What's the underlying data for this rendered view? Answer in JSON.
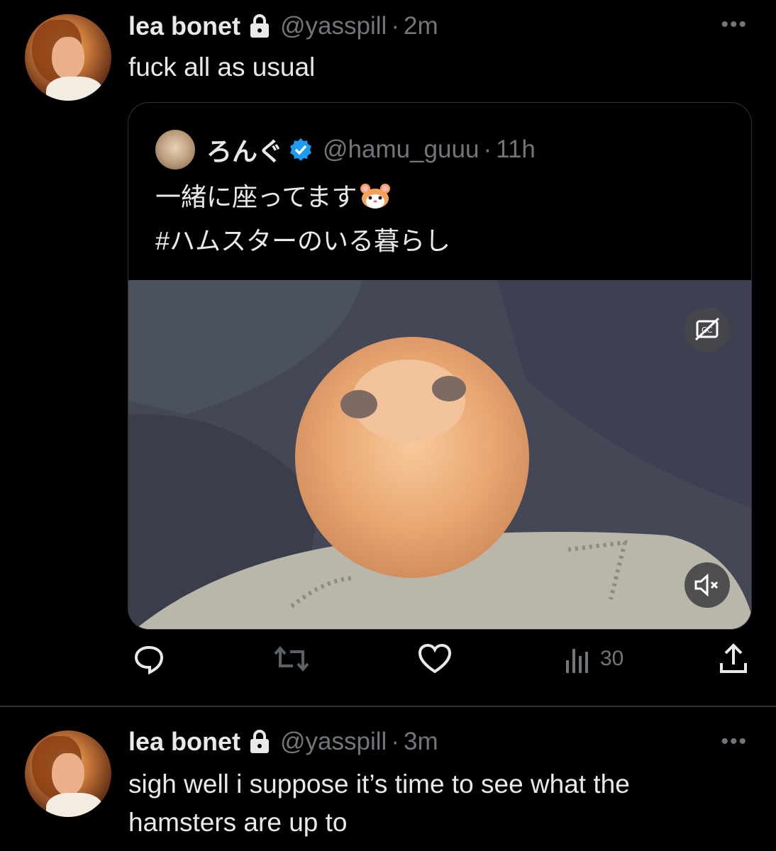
{
  "tweet1": {
    "display_name": "lea bonet",
    "handle": "@yasspill",
    "separator": "·",
    "time": "2m",
    "text": "fuck all as usual"
  },
  "quote": {
    "display_name": "ろんぐ",
    "handle": "@hamu_guuu",
    "separator": "·",
    "time": "11h",
    "line1": "一緒に座ってます",
    "line2": "#ハムスターのいる暮らし"
  },
  "actions": {
    "views": "30"
  },
  "tweet2": {
    "display_name": "lea bonet",
    "handle": "@yasspill",
    "separator": "·",
    "time": "3m",
    "text_line1": "sigh well i suppose it’s time to see what the",
    "text_line2": "hamsters are up to"
  },
  "colors": {
    "background": "#000000",
    "text": "#e7e9ea",
    "muted": "#71767b",
    "border": "#2f3336",
    "verified": "#1d9bf0"
  },
  "icons": [
    "lock-icon",
    "more-icon",
    "verified-icon",
    "cc-icon",
    "mute-icon",
    "reply-icon",
    "retweet-icon",
    "like-icon",
    "views-icon",
    "share-icon"
  ]
}
